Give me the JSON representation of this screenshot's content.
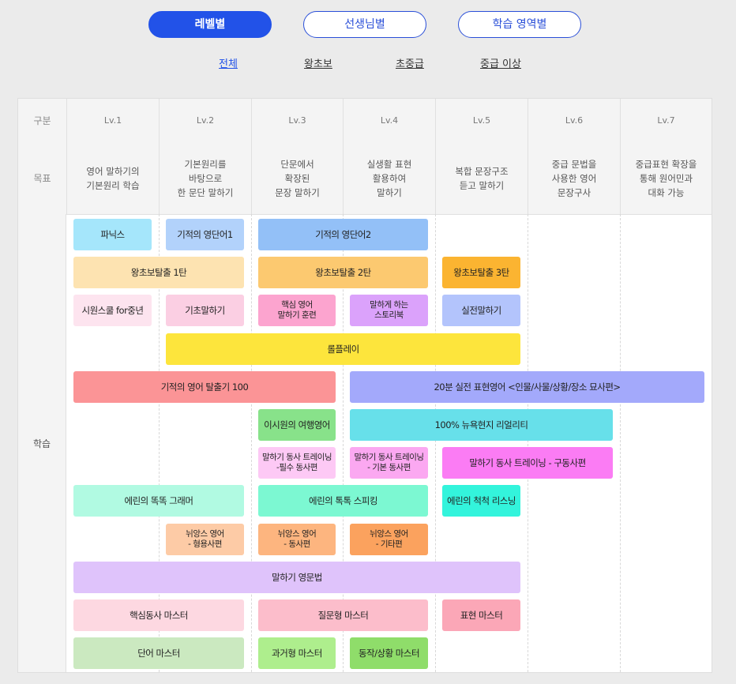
{
  "tabs": [
    "레벨별",
    "선생님별",
    "학습 영역별"
  ],
  "subtabs": [
    "전체",
    "왕초보",
    "초중급",
    "중급 이상"
  ],
  "table": {
    "row_header_label": "구분",
    "goal_label": "목표",
    "learning_label": "학습",
    "levels": [
      "Lv.1",
      "Lv.2",
      "Lv.3",
      "Lv.4",
      "Lv.5",
      "Lv.6",
      "Lv.7"
    ],
    "goals": [
      "영어 말하기의\n기본원리 학습",
      "기본원리를\n바탕으로\n한 문단 말하기",
      "단문에서\n확장된\n문장 말하기",
      "실생활 표현\n활용하여\n말하기",
      "복합 문장구조\n듣고 말하기",
      "중급 문법을\n사용한 영어\n문장구사",
      "중급표현 확장을\n통해 원어민과\n대화 가능"
    ]
  },
  "courses": [
    {
      "label": "파닉스",
      "color": "#a5e6fb",
      "row": 0,
      "start": 1,
      "end": 1
    },
    {
      "label": "기적의 영단어1",
      "color": "#b2d2fb",
      "row": 0,
      "start": 2,
      "end": 2
    },
    {
      "label": "기적의 영단어2",
      "color": "#93c0f7",
      "row": 0,
      "start": 3,
      "end": 4
    },
    {
      "label": "왕초보탈출 1탄",
      "color": "#fde3b1",
      "row": 1,
      "start": 1,
      "end": 2
    },
    {
      "label": "왕초보탈출 2탄",
      "color": "#fcc970",
      "row": 1,
      "start": 3,
      "end": 4
    },
    {
      "label": "왕초보탈출 3탄",
      "color": "#fbb431",
      "row": 1,
      "start": 5,
      "end": 5
    },
    {
      "label": "시원스쿨 for중년",
      "color": "#fde4ef",
      "row": 2,
      "start": 1,
      "end": 1
    },
    {
      "label": "기초말하기",
      "color": "#fbcfe3",
      "row": 2,
      "start": 2,
      "end": 2
    },
    {
      "label": "핵심 영어\n말하기 훈련",
      "color": "#fca4cf",
      "row": 2,
      "start": 3,
      "end": 3
    },
    {
      "label": "말하게 하는\n스토리북",
      "color": "#dba2fb",
      "row": 2,
      "start": 4,
      "end": 4
    },
    {
      "label": "실전말하기",
      "color": "#b3c4fc",
      "row": 2,
      "start": 5,
      "end": 5
    },
    {
      "label": "롤플레이",
      "color": "#fde53c",
      "row": 3,
      "start": 2,
      "end": 5
    },
    {
      "label": "기적의 영어 탈출기 100",
      "color": "#fb9496",
      "row": 4,
      "start": 1,
      "end": 3
    },
    {
      "label": "20분 실전 표현영어 <인물/사물/상황/장소 묘사편>",
      "color": "#a3a9fb",
      "row": 4,
      "start": 4,
      "end": 7
    },
    {
      "label": "이시원의 여행영어",
      "color": "#88e28a",
      "row": 5,
      "start": 3,
      "end": 3
    },
    {
      "label": "100% 뉴욕현지 리얼리티",
      "color": "#67e0ea",
      "row": 5,
      "start": 4,
      "end": 6
    },
    {
      "label": "말하기 동사 트레이닝\n-필수 동사편",
      "color": "#fdc9f5",
      "row": 6,
      "start": 3,
      "end": 3
    },
    {
      "label": "말하기 동사 트레이닝\n- 기본 동사편",
      "color": "#fba8f1",
      "row": 6,
      "start": 4,
      "end": 4
    },
    {
      "label": "말하기 동사 트레이닝 - 구동사편",
      "color": "#fb7cf4",
      "row": 6,
      "start": 5,
      "end": 6
    },
    {
      "label": "에린의 똑똑 그래머",
      "color": "#b1fae2",
      "row": 7,
      "start": 1,
      "end": 2
    },
    {
      "label": "에린의 톡톡 스피킹",
      "color": "#7cf8d2",
      "row": 7,
      "start": 3,
      "end": 4
    },
    {
      "label": "에린의 척척 리스닝",
      "color": "#33f4dc",
      "row": 7,
      "start": 5,
      "end": 5
    },
    {
      "label": "뉘앙스 영어\n- 형용사편",
      "color": "#fdcba6",
      "row": 8,
      "start": 2,
      "end": 2
    },
    {
      "label": "뉘앙스 영어\n- 동사편",
      "color": "#fdb57f",
      "row": 8,
      "start": 3,
      "end": 3
    },
    {
      "label": "뉘앙스 영어\n- 기타편",
      "color": "#fba25e",
      "row": 8,
      "start": 4,
      "end": 4
    },
    {
      "label": "말하기 영문법",
      "color": "#dfc3fb",
      "row": 9,
      "start": 1,
      "end": 5
    },
    {
      "label": "핵심동사 마스터",
      "color": "#fdd8e1",
      "row": 10,
      "start": 1,
      "end": 2
    },
    {
      "label": "질문형 마스터",
      "color": "#fcbdcb",
      "row": 10,
      "start": 3,
      "end": 4
    },
    {
      "label": "표현 마스터",
      "color": "#fba7b7",
      "row": 10,
      "start": 5,
      "end": 5
    },
    {
      "label": "단어 마스터",
      "color": "#cbe9c0",
      "row": 11,
      "start": 1,
      "end": 2
    },
    {
      "label": "과거형 마스터",
      "color": "#aeee8d",
      "row": 11,
      "start": 3,
      "end": 3
    },
    {
      "label": "동작/상황 마스터",
      "color": "#8fdd6a",
      "row": 11,
      "start": 4,
      "end": 4
    }
  ]
}
